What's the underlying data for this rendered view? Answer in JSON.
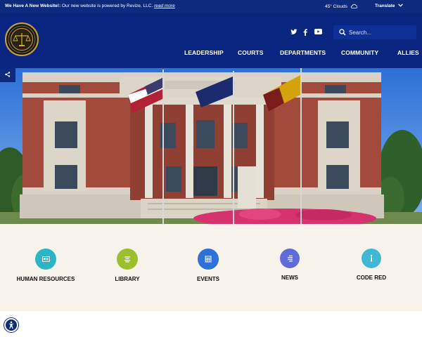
{
  "topbar": {
    "announce_title": "We Have A New Website!:",
    "announce_text": "Our new website is powered by Revize, LLC.",
    "announce_link": "read more",
    "weather": "45° Clouds",
    "weather_icon": "cloud-icon",
    "translate": "Translate"
  },
  "header": {
    "logo_icon": "county-seal",
    "search_placeholder": "Search...",
    "social": [
      "twitter-icon",
      "facebook-icon",
      "youtube-icon"
    ],
    "nav": [
      "LEADERSHIP",
      "COURTS",
      "DEPARTMENTS",
      "COMMUNITY",
      "ALLIES"
    ]
  },
  "quick_links": [
    {
      "label": "HUMAN RESOURCES",
      "color": "#2bb5c7",
      "icon": "id-card-icon"
    },
    {
      "label": "LIBRARY",
      "color": "#9bbf2f",
      "icon": "book-icon"
    },
    {
      "label": "EVENTS",
      "color": "#2d72d9",
      "icon": "calendar-icon"
    },
    {
      "label": "NEWS",
      "color": "#5e6bd8",
      "icon": "newspaper-icon"
    },
    {
      "label": "CODE RED",
      "color": "#41b7d6",
      "icon": "info-icon"
    }
  ],
  "colors": {
    "navy": "#0a2580",
    "topbar": "#0d2a7c",
    "cream": "#f7f2ea"
  }
}
